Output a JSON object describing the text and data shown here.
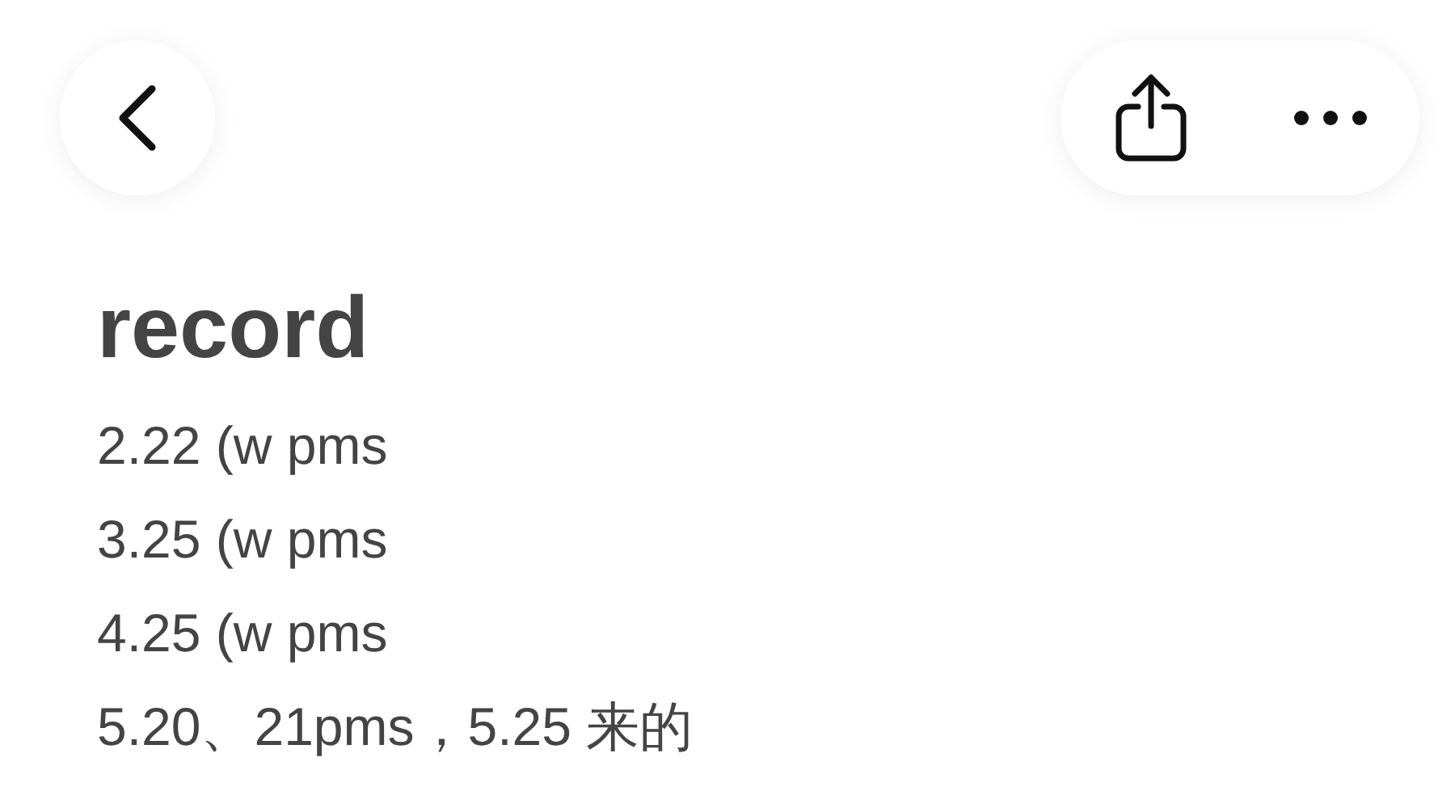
{
  "note": {
    "title": "record",
    "lines": [
      "2.22 (w pms",
      "3.25 (w pms",
      "4.25 (w pms",
      "5.20、21pms，5.25 来的"
    ]
  }
}
